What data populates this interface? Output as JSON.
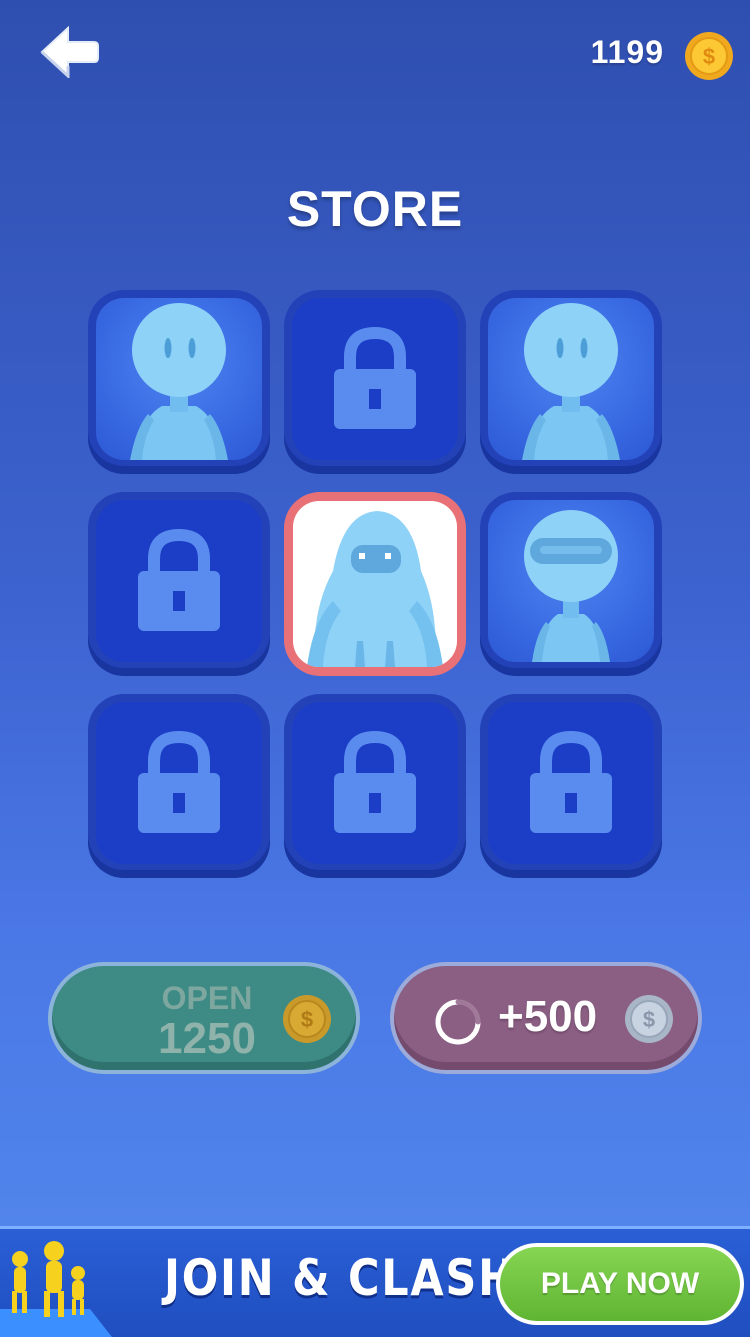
{
  "header": {
    "back_icon": "arrow-left-icon",
    "coins": "1199",
    "coin_icon": "gold-coin-icon"
  },
  "title": "STORE",
  "grid": {
    "tiles": [
      {
        "row": 1,
        "col": 1,
        "state": "unlocked",
        "character": "basic-stickman"
      },
      {
        "row": 1,
        "col": 2,
        "state": "locked"
      },
      {
        "row": 1,
        "col": 3,
        "state": "unlocked",
        "character": "basic-stickman"
      },
      {
        "row": 2,
        "col": 1,
        "state": "locked"
      },
      {
        "row": 2,
        "col": 2,
        "state": "selected",
        "character": "hooded-bean"
      },
      {
        "row": 2,
        "col": 3,
        "state": "unlocked",
        "character": "visor-helmet"
      },
      {
        "row": 3,
        "col": 1,
        "state": "locked"
      },
      {
        "row": 3,
        "col": 2,
        "state": "locked"
      },
      {
        "row": 3,
        "col": 3,
        "state": "locked"
      }
    ]
  },
  "buttons": {
    "open_label": "OPEN",
    "open_price": "1250",
    "ad_reward": "+500"
  },
  "banner": {
    "title": "JOIN & CLASH",
    "cta": "PLAY NOW"
  },
  "colors": {
    "tile_bg": "#1c3ec6",
    "selected_border": "#e77176",
    "character": "#7cc6f4",
    "open_button": "#3e8b86",
    "ad_button": "#8b5e83",
    "play_button": "#6cc23c"
  }
}
